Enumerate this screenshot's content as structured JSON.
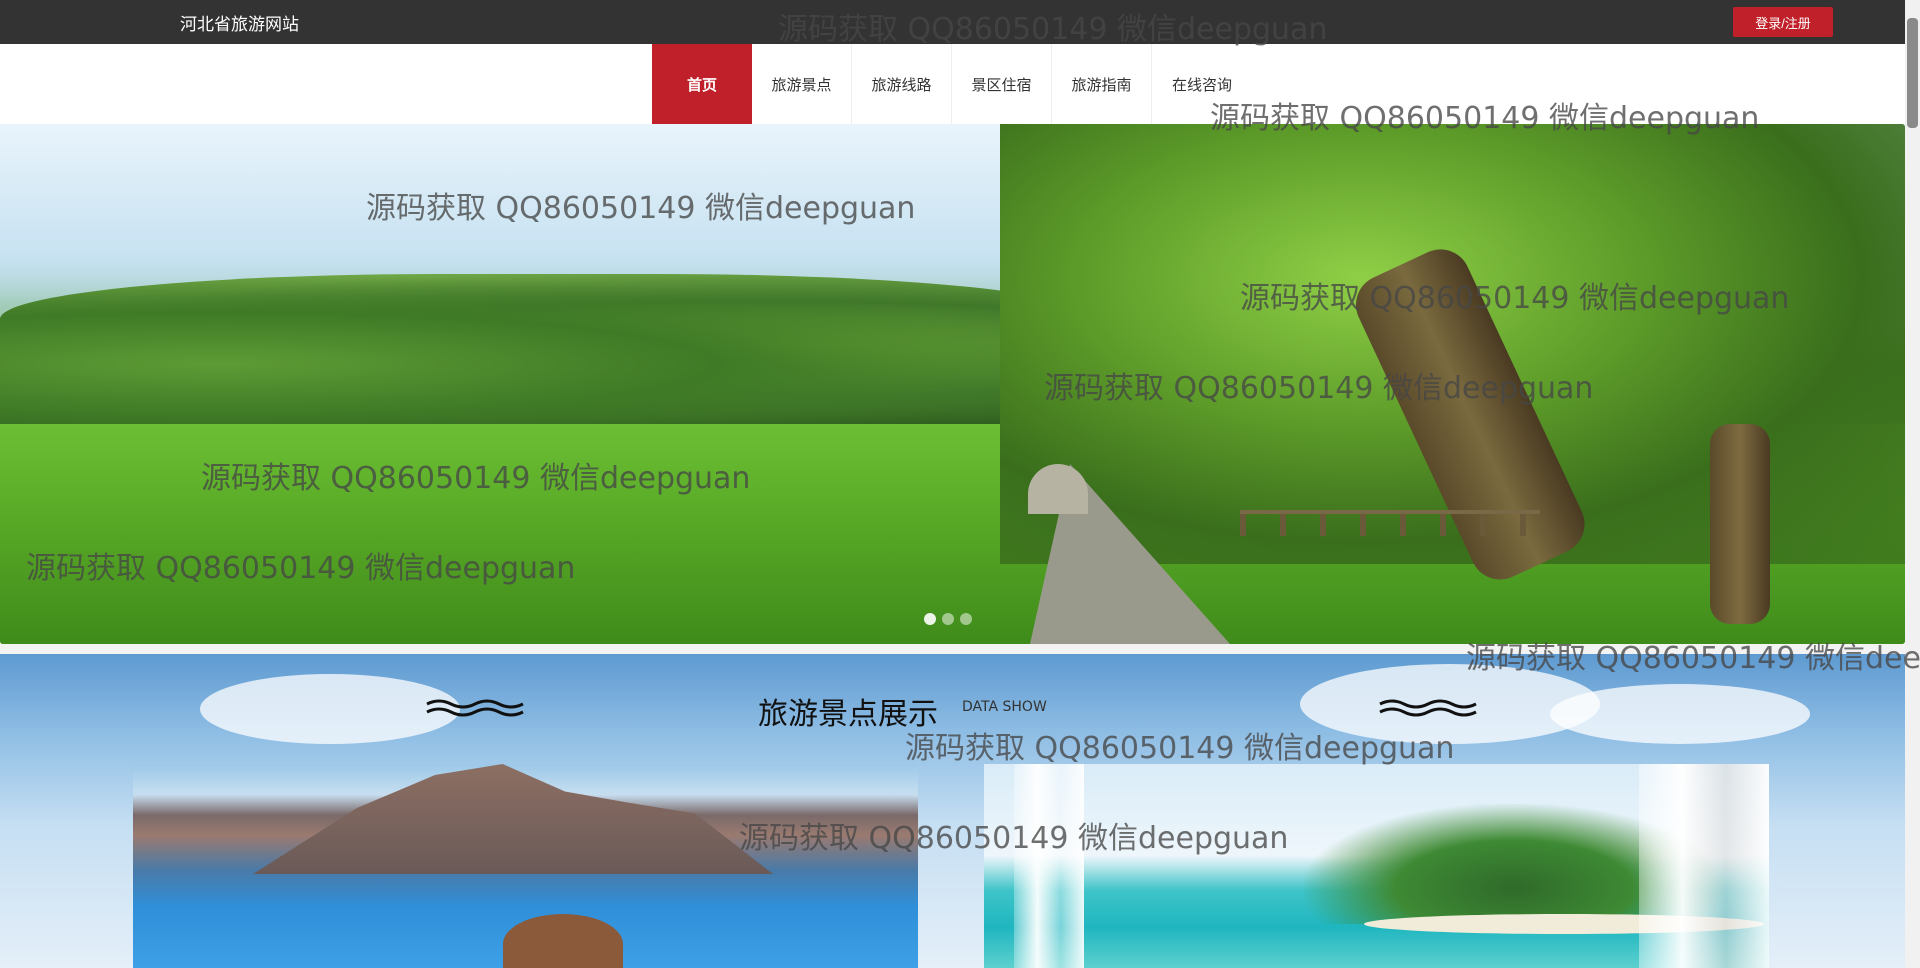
{
  "header": {
    "site_title": "河北省旅游网站",
    "login_label": "登录/注册"
  },
  "nav": {
    "items": [
      "首页",
      "旅游景点",
      "旅游线路",
      "景区住宿",
      "旅游指南",
      "在线咨询"
    ],
    "active_index": 0
  },
  "banner": {
    "slide_count": 3,
    "active_slide": 0
  },
  "section": {
    "title": "旅游景点展示",
    "subtitle": "DATA SHOW"
  },
  "watermark": {
    "text": "源码获取 QQ86050149 微信deepguan",
    "truncated_text": "源码获取 QQ86050149 微信deep"
  },
  "colors": {
    "accent": "#c0202a",
    "topbar": "#333333"
  }
}
